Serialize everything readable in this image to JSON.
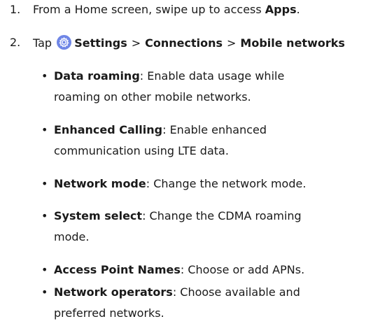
{
  "steps": [
    {
      "number": "1.",
      "prefix": "From a Home screen, swipe up to access ",
      "bold": "Apps",
      "suffix": "."
    },
    {
      "number": "2.",
      "prefix": "Tap",
      "path": [
        "Settings",
        "Connections",
        "Mobile networks"
      ],
      "separator": ">"
    }
  ],
  "bullets": [
    {
      "term": "Data roaming",
      "line1": ": Enable data usage while",
      "line2": "roaming on other mobile networks."
    },
    {
      "term": "Enhanced Calling",
      "line1": ": Enable enhanced",
      "line2": "communication using LTE data."
    },
    {
      "term": "Network mode",
      "line1": ": Change the network mode.",
      "line2": ""
    },
    {
      "term": "System select",
      "line1": ": Change the CDMA roaming",
      "line2": "mode."
    },
    {
      "term": "Access Point Names",
      "line1": ": Choose or add APNs.",
      "line2": ""
    },
    {
      "term": "Network operators",
      "line1": ": Choose available and",
      "line2": "preferred networks."
    }
  ],
  "bullet_char": "•",
  "icons": {
    "settings": "settings-gear-icon"
  },
  "colors": {
    "text": "#1a1a1a",
    "settings_icon": "#6f86e6"
  }
}
